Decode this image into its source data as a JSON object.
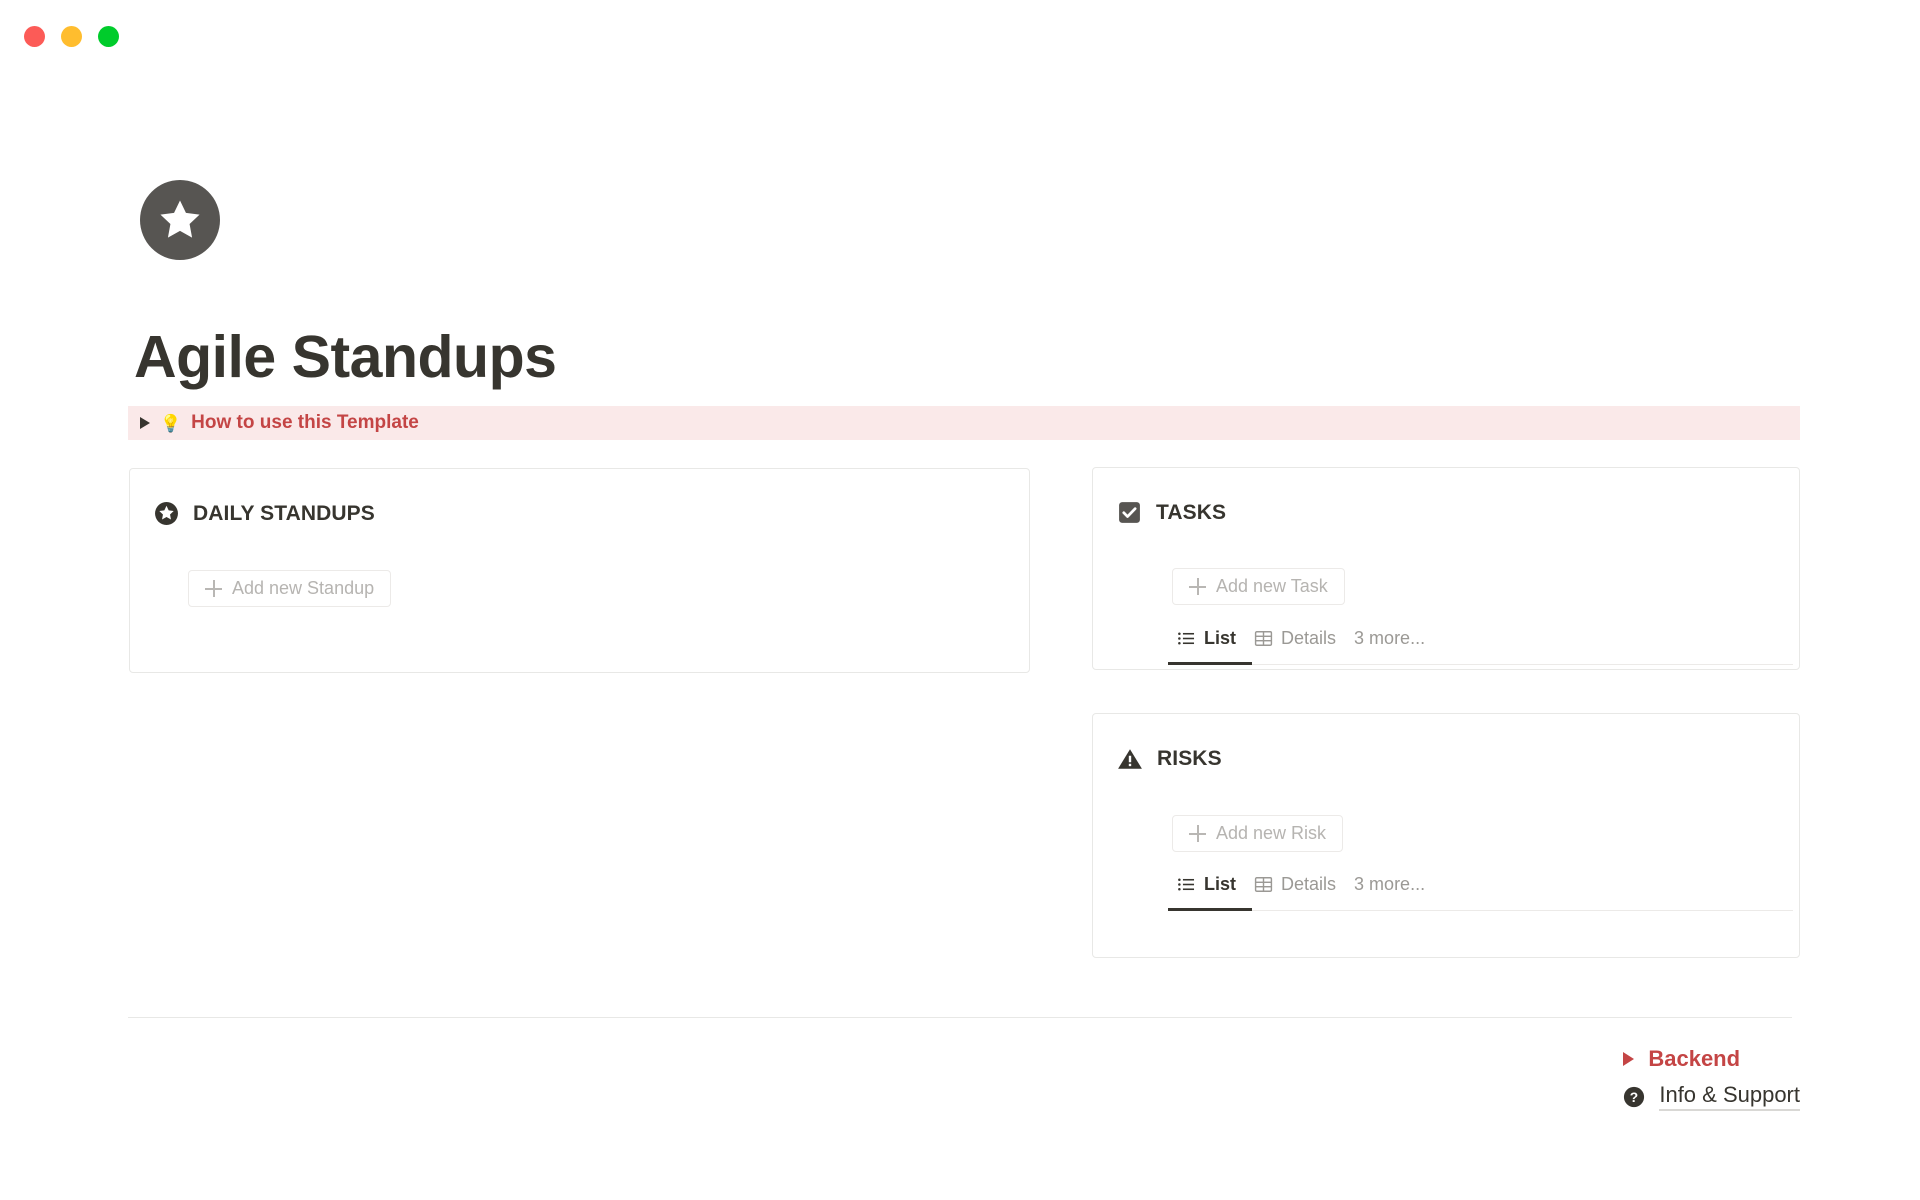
{
  "window": {
    "traffic_lights": [
      {
        "name": "close",
        "color": "#fc5b57"
      },
      {
        "name": "minimize",
        "color": "#ffbd2e"
      },
      {
        "name": "maximize",
        "color": "#00cc2b"
      }
    ]
  },
  "page": {
    "icon": "star-circle-icon",
    "title": "Agile Standups"
  },
  "callout": {
    "toggle": "collapsed-triangle",
    "emoji": "💡",
    "text": "How to use this Template",
    "background_color": "#fae9e9",
    "text_color": "#c44545"
  },
  "cards": {
    "standups": {
      "icon": "star-circle-icon",
      "title": "DAILY STANDUPS",
      "add_button_label": "Add new Standup"
    },
    "tasks": {
      "icon": "check-square-icon",
      "title": "TASKS",
      "add_button_label": "Add new Task",
      "tabs": [
        {
          "label": "List",
          "icon": "list-icon",
          "active": true
        },
        {
          "label": "Details",
          "icon": "table-icon",
          "active": false
        }
      ],
      "more_label": "3 more..."
    },
    "risks": {
      "icon": "warning-triangle-icon",
      "title": "RISKS",
      "add_button_label": "Add new Risk",
      "tabs": [
        {
          "label": "List",
          "icon": "list-icon",
          "active": true
        },
        {
          "label": "Details",
          "icon": "table-icon",
          "active": false
        }
      ],
      "more_label": "3 more..."
    }
  },
  "footer": {
    "backend_label": "Backend",
    "backend_color": "#c44545",
    "info_label": "Info & Support",
    "info_icon": "help-circle-icon"
  }
}
